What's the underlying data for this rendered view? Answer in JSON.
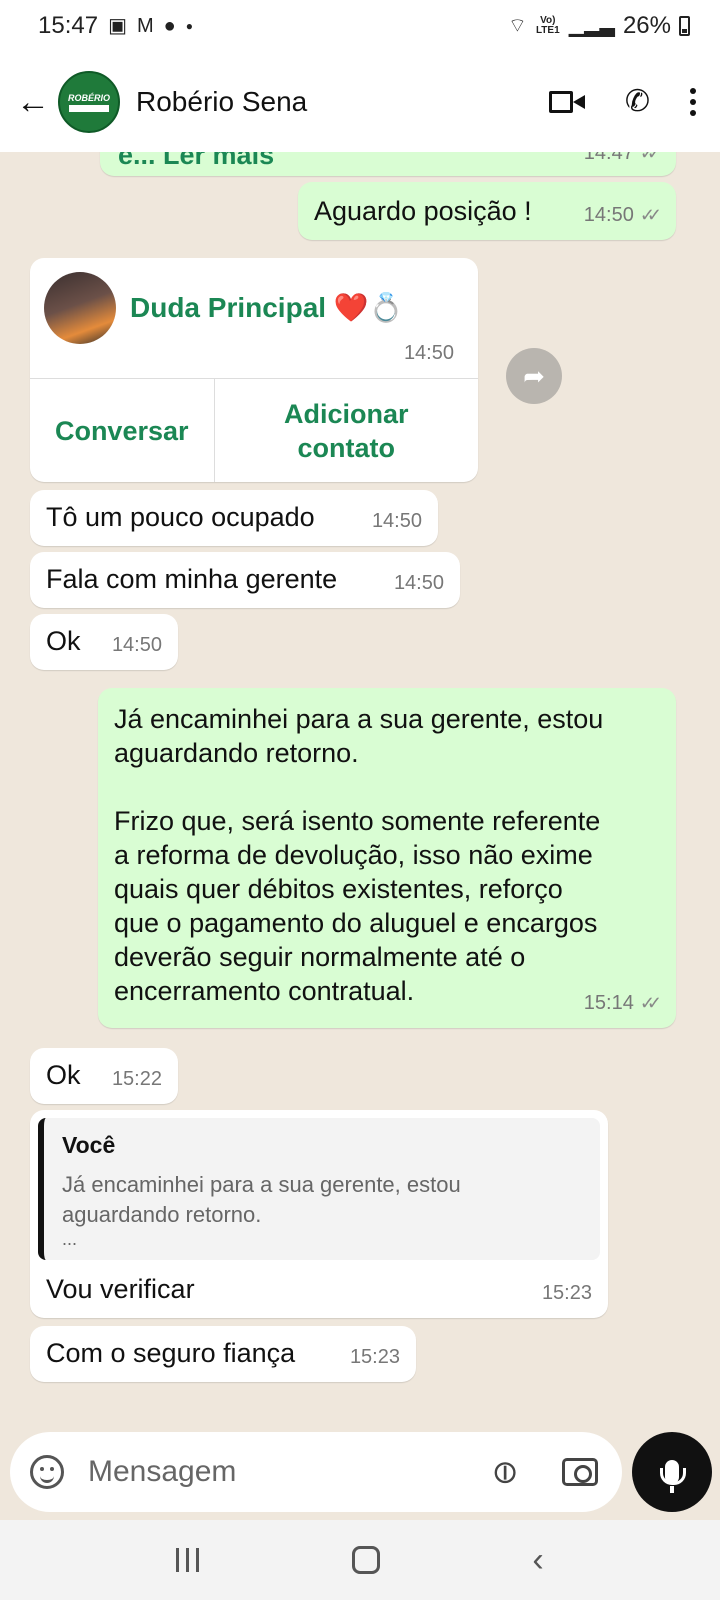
{
  "status_bar": {
    "time": "15:47",
    "battery": "26%",
    "network": "Vo) LTE1"
  },
  "header": {
    "contact_name": "Robério Sena",
    "avatar_text": "ROBÉRIO"
  },
  "messages": {
    "m0": {
      "text": "e... Ler mais",
      "time": "14:47"
    },
    "m1": {
      "text": "Aguardo posição !",
      "time": "14:50"
    },
    "card": {
      "name": "Duda Principal ❤️💍",
      "time": "14:50",
      "btn1": "Conversar",
      "btn2": "Adicionar contato"
    },
    "m2": {
      "text": "Tô um pouco ocupado",
      "time": "14:50"
    },
    "m3": {
      "text": "Fala com minha gerente",
      "time": "14:50"
    },
    "m4": {
      "text": "Ok",
      "time": "14:50"
    },
    "m5": {
      "line1": "Já  encaminhei para a sua gerente, estou",
      "line2": "aguardando  retorno.",
      "line3": "Frizo que, será isento somente referente",
      "line4": "a reforma de devolução, isso não exime",
      "line5": "quais quer débitos existentes, reforço",
      "line6": "que  o pagamento do aluguel e encargos",
      "line7": "deverão seguir normalmente até  o",
      "line8": "encerramento contratual.",
      "time": "15:14"
    },
    "m6": {
      "text": "Ok",
      "time": "15:22"
    },
    "m7": {
      "quote_author": "Você",
      "quote_line1": "Já  encaminhei para a sua gerente, estou",
      "quote_line2": "aguardando  retorno.",
      "quote_more": "...",
      "text": "Vou verificar",
      "time": "15:23"
    },
    "m8": {
      "text": "Com o seguro fiança",
      "time": "15:23"
    }
  },
  "input": {
    "placeholder": "Mensagem"
  },
  "icons": [
    "back-arrow-icon",
    "video-call-icon",
    "phone-icon",
    "more-options-icon",
    "forward-icon",
    "emoji-icon",
    "attach-icon",
    "camera-icon",
    "mic-icon"
  ],
  "colors": {
    "outgoing_bubble": "#d9fdd3",
    "incoming_bubble": "#ffffff",
    "accent_green": "#1b8754",
    "chat_bg": "#efe7dc"
  }
}
